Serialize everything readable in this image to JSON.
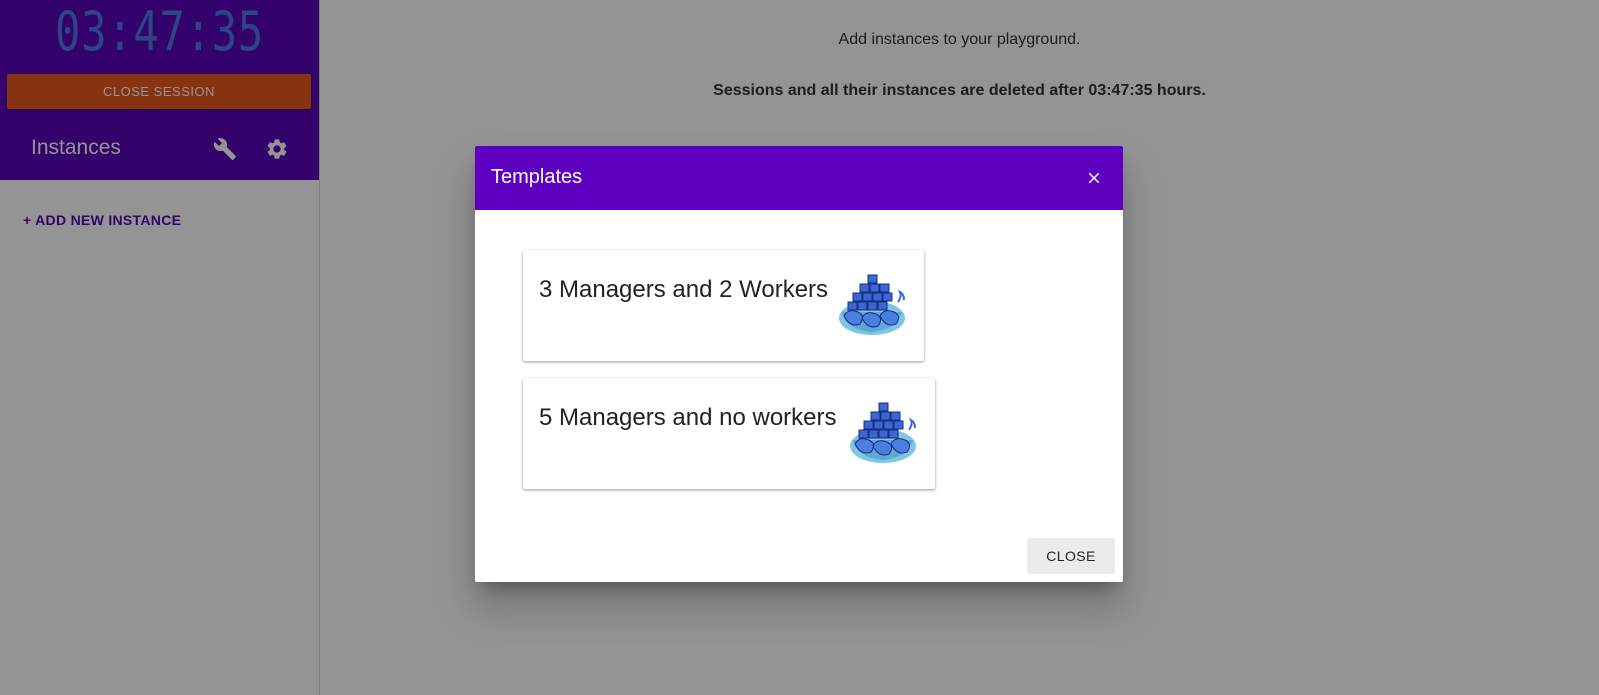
{
  "sidebar": {
    "clock": "03:47:35",
    "close_session_label": "CLOSE SESSION",
    "instances_title": "Instances",
    "add_instance_label": "+ ADD NEW INSTANCE"
  },
  "main": {
    "info_text": "Add instances to your playground.",
    "expiry_text": "Sessions and all their instances are deleted after 03:47:35 hours."
  },
  "dialog": {
    "title": "Templates",
    "templates": [
      {
        "label": "3 Managers and 2 Workers",
        "icon": "docker-swarm-whale-icon"
      },
      {
        "label": "5 Managers and no workers",
        "icon": "docker-swarm-whale-icon"
      }
    ],
    "close_label": "CLOSE"
  },
  "colors": {
    "primary": "#5e00bf",
    "sidebar_header": "#5a05b8",
    "clock": "#4d78e8",
    "close_session": "#e8571c",
    "backdrop": "rgba(0,0,0,0.42)"
  }
}
